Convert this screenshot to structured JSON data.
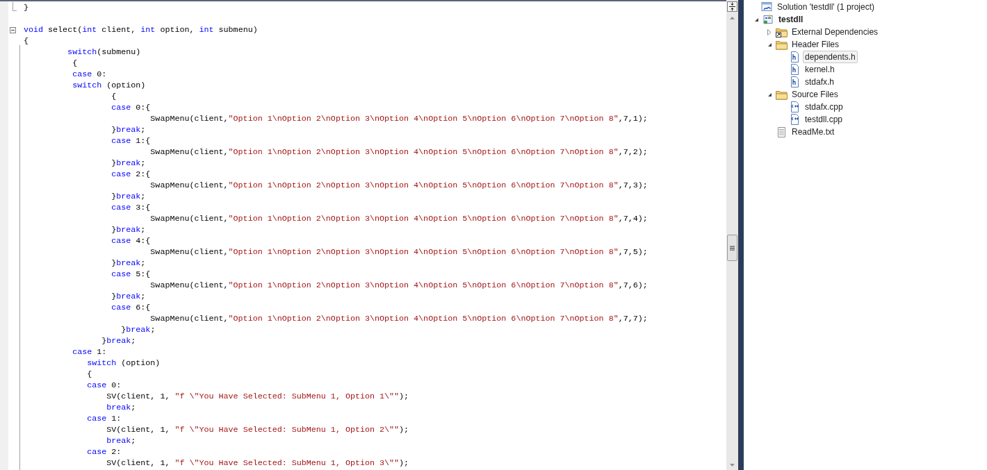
{
  "editor": {
    "lines": [
      {
        "kind": "fold_end",
        "segments": [
          {
            "kind": "text",
            "text": "}"
          }
        ]
      },
      {
        "kind": "blank"
      },
      {
        "kind": "fold_start",
        "segments": [
          {
            "kind": "keyword",
            "text": "void"
          },
          {
            "kind": "text",
            "text": " select("
          },
          {
            "kind": "keyword",
            "text": "int"
          },
          {
            "kind": "text",
            "text": " client, "
          },
          {
            "kind": "keyword",
            "text": "int"
          },
          {
            "kind": "text",
            "text": " option, "
          },
          {
            "kind": "keyword",
            "text": "int"
          },
          {
            "kind": "text",
            "text": " submenu)"
          }
        ]
      },
      {
        "kind": "code",
        "segments": [
          {
            "kind": "text",
            "text": "{"
          }
        ]
      },
      {
        "kind": "code",
        "segments": [
          {
            "kind": "keyword",
            "text": "         switch"
          },
          {
            "kind": "text",
            "text": "(submenu)"
          }
        ]
      },
      {
        "kind": "code",
        "segments": [
          {
            "kind": "text",
            "text": "          {"
          }
        ]
      },
      {
        "kind": "code",
        "segments": [
          {
            "kind": "keyword",
            "text": "          case"
          },
          {
            "kind": "text",
            "text": " 0:"
          }
        ]
      },
      {
        "kind": "code",
        "segments": [
          {
            "kind": "keyword",
            "text": "          switch"
          },
          {
            "kind": "text",
            "text": " (option)"
          }
        ]
      },
      {
        "kind": "code",
        "segments": [
          {
            "kind": "text",
            "text": "                  {"
          }
        ]
      },
      {
        "kind": "code",
        "segments": [
          {
            "kind": "keyword",
            "text": "                  case"
          },
          {
            "kind": "text",
            "text": " 0:{"
          }
        ]
      },
      {
        "kind": "code",
        "segments": [
          {
            "kind": "text",
            "text": "                          SwapMenu(client,"
          },
          {
            "kind": "string",
            "text": "\"Option 1\\nOption 2\\nOption 3\\nOption 4\\nOption 5\\nOption 6\\nOption 7\\nOption 8\""
          },
          {
            "kind": "text",
            "text": ",7,1);"
          }
        ]
      },
      {
        "kind": "code",
        "segments": [
          {
            "kind": "text",
            "text": "                  }"
          },
          {
            "kind": "keyword",
            "text": "break"
          },
          {
            "kind": "text",
            "text": ";"
          }
        ]
      },
      {
        "kind": "code",
        "segments": [
          {
            "kind": "keyword",
            "text": "                  case"
          },
          {
            "kind": "text",
            "text": " 1:{"
          }
        ]
      },
      {
        "kind": "code",
        "segments": [
          {
            "kind": "text",
            "text": "                          SwapMenu(client,"
          },
          {
            "kind": "string",
            "text": "\"Option 1\\nOption 2\\nOption 3\\nOption 4\\nOption 5\\nOption 6\\nOption 7\\nOption 8\""
          },
          {
            "kind": "text",
            "text": ",7,2);"
          }
        ]
      },
      {
        "kind": "code",
        "segments": [
          {
            "kind": "text",
            "text": "                  }"
          },
          {
            "kind": "keyword",
            "text": "break"
          },
          {
            "kind": "text",
            "text": ";"
          }
        ]
      },
      {
        "kind": "code",
        "segments": [
          {
            "kind": "keyword",
            "text": "                  case"
          },
          {
            "kind": "text",
            "text": " 2:{"
          }
        ]
      },
      {
        "kind": "code",
        "segments": [
          {
            "kind": "text",
            "text": "                          SwapMenu(client,"
          },
          {
            "kind": "string",
            "text": "\"Option 1\\nOption 2\\nOption 3\\nOption 4\\nOption 5\\nOption 6\\nOption 7\\nOption 8\""
          },
          {
            "kind": "text",
            "text": ",7,3);"
          }
        ]
      },
      {
        "kind": "code",
        "segments": [
          {
            "kind": "text",
            "text": "                  }"
          },
          {
            "kind": "keyword",
            "text": "break"
          },
          {
            "kind": "text",
            "text": ";"
          }
        ]
      },
      {
        "kind": "code",
        "segments": [
          {
            "kind": "keyword",
            "text": "                  case"
          },
          {
            "kind": "text",
            "text": " 3:{"
          }
        ]
      },
      {
        "kind": "code",
        "segments": [
          {
            "kind": "text",
            "text": "                          SwapMenu(client,"
          },
          {
            "kind": "string",
            "text": "\"Option 1\\nOption 2\\nOption 3\\nOption 4\\nOption 5\\nOption 6\\nOption 7\\nOption 8\""
          },
          {
            "kind": "text",
            "text": ",7,4);"
          }
        ]
      },
      {
        "kind": "code",
        "segments": [
          {
            "kind": "text",
            "text": "                  }"
          },
          {
            "kind": "keyword",
            "text": "break"
          },
          {
            "kind": "text",
            "text": ";"
          }
        ]
      },
      {
        "kind": "code",
        "segments": [
          {
            "kind": "keyword",
            "text": "                  case"
          },
          {
            "kind": "text",
            "text": " 4:{"
          }
        ]
      },
      {
        "kind": "code",
        "segments": [
          {
            "kind": "text",
            "text": "                          SwapMenu(client,"
          },
          {
            "kind": "string",
            "text": "\"Option 1\\nOption 2\\nOption 3\\nOption 4\\nOption 5\\nOption 6\\nOption 7\\nOption 8\""
          },
          {
            "kind": "text",
            "text": ",7,5);"
          }
        ]
      },
      {
        "kind": "code",
        "segments": [
          {
            "kind": "text",
            "text": "                  }"
          },
          {
            "kind": "keyword",
            "text": "break"
          },
          {
            "kind": "text",
            "text": ";"
          }
        ]
      },
      {
        "kind": "code",
        "segments": [
          {
            "kind": "keyword",
            "text": "                  case"
          },
          {
            "kind": "text",
            "text": " 5:{"
          }
        ]
      },
      {
        "kind": "code",
        "segments": [
          {
            "kind": "text",
            "text": "                          SwapMenu(client,"
          },
          {
            "kind": "string",
            "text": "\"Option 1\\nOption 2\\nOption 3\\nOption 4\\nOption 5\\nOption 6\\nOption 7\\nOption 8\""
          },
          {
            "kind": "text",
            "text": ",7,6);"
          }
        ]
      },
      {
        "kind": "code",
        "segments": [
          {
            "kind": "text",
            "text": "                  }"
          },
          {
            "kind": "keyword",
            "text": "break"
          },
          {
            "kind": "text",
            "text": ";"
          }
        ]
      },
      {
        "kind": "code",
        "segments": [
          {
            "kind": "keyword",
            "text": "                  case"
          },
          {
            "kind": "text",
            "text": " 6:{"
          }
        ]
      },
      {
        "kind": "code",
        "segments": [
          {
            "kind": "text",
            "text": "                          SwapMenu(client,"
          },
          {
            "kind": "string",
            "text": "\"Option 1\\nOption 2\\nOption 3\\nOption 4\\nOption 5\\nOption 6\\nOption 7\\nOption 8\""
          },
          {
            "kind": "text",
            "text": ",7,7);"
          }
        ]
      },
      {
        "kind": "code",
        "segments": [
          {
            "kind": "text",
            "text": "                    }"
          },
          {
            "kind": "keyword",
            "text": "break"
          },
          {
            "kind": "text",
            "text": ";"
          }
        ]
      },
      {
        "kind": "code",
        "segments": [
          {
            "kind": "text",
            "text": "                }"
          },
          {
            "kind": "keyword",
            "text": "break"
          },
          {
            "kind": "text",
            "text": ";"
          }
        ]
      },
      {
        "kind": "code",
        "segments": [
          {
            "kind": "keyword",
            "text": "          case"
          },
          {
            "kind": "text",
            "text": " 1:"
          }
        ]
      },
      {
        "kind": "code",
        "segments": [
          {
            "kind": "keyword",
            "text": "             switch"
          },
          {
            "kind": "text",
            "text": " (option)"
          }
        ]
      },
      {
        "kind": "code",
        "segments": [
          {
            "kind": "text",
            "text": "             {"
          }
        ]
      },
      {
        "kind": "code",
        "segments": [
          {
            "kind": "keyword",
            "text": "             case"
          },
          {
            "kind": "text",
            "text": " 0:"
          }
        ]
      },
      {
        "kind": "code",
        "segments": [
          {
            "kind": "text",
            "text": "                 SV(client, 1, "
          },
          {
            "kind": "string",
            "text": "\"f \\\"You Have Selected: SubMenu 1, Option 1\\\"\""
          },
          {
            "kind": "text",
            "text": ");"
          }
        ]
      },
      {
        "kind": "code",
        "segments": [
          {
            "kind": "keyword",
            "text": "                 break"
          },
          {
            "kind": "text",
            "text": ";"
          }
        ]
      },
      {
        "kind": "code",
        "segments": [
          {
            "kind": "keyword",
            "text": "             case"
          },
          {
            "kind": "text",
            "text": " 1:"
          }
        ]
      },
      {
        "kind": "code",
        "segments": [
          {
            "kind": "text",
            "text": "                 SV(client, 1, "
          },
          {
            "kind": "string",
            "text": "\"f \\\"You Have Selected: SubMenu 1, Option 2\\\"\""
          },
          {
            "kind": "text",
            "text": ");"
          }
        ]
      },
      {
        "kind": "code",
        "segments": [
          {
            "kind": "keyword",
            "text": "                 break"
          },
          {
            "kind": "text",
            "text": ";"
          }
        ]
      },
      {
        "kind": "code",
        "segments": [
          {
            "kind": "keyword",
            "text": "             case"
          },
          {
            "kind": "text",
            "text": " 2:"
          }
        ]
      },
      {
        "kind": "code",
        "segments": [
          {
            "kind": "text",
            "text": "                 SV(client, 1, "
          },
          {
            "kind": "string",
            "text": "\"f \\\"You Have Selected: SubMenu 1, Option 3\\\"\""
          },
          {
            "kind": "text",
            "text": ");"
          }
        ]
      }
    ]
  },
  "solution_explorer": {
    "items": [
      {
        "label": "Solution 'testdll' (1 project)",
        "kind": "solution",
        "selected": false,
        "children": [
          {
            "label": "testdll",
            "kind": "project",
            "bold": true,
            "expanded": true,
            "selected": false,
            "children": [
              {
                "label": "External Dependencies",
                "kind": "folder_link",
                "expanded": false,
                "selected": false
              },
              {
                "label": "Header Files",
                "kind": "folder",
                "expanded": true,
                "selected": false,
                "children": [
                  {
                    "label": "dependents.h",
                    "kind": "header",
                    "selected": true
                  },
                  {
                    "label": "kernel.h",
                    "kind": "header",
                    "selected": false
                  },
                  {
                    "label": "stdafx.h",
                    "kind": "header",
                    "selected": false
                  }
                ]
              },
              {
                "label": "Source Files",
                "kind": "folder",
                "expanded": true,
                "selected": false,
                "children": [
                  {
                    "label": "stdafx.cpp",
                    "kind": "cpp",
                    "selected": false
                  },
                  {
                    "label": "testdll.cpp",
                    "kind": "cpp",
                    "selected": false
                  }
                ]
              },
              {
                "label": "ReadMe.txt",
                "kind": "text",
                "selected": false
              }
            ]
          }
        ]
      }
    ]
  }
}
